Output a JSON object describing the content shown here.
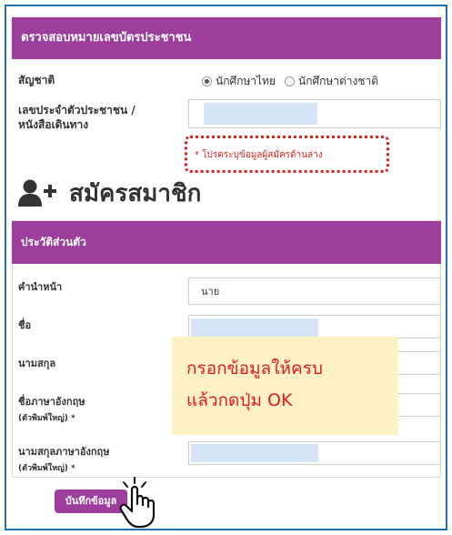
{
  "verify_section": {
    "header": "ตรวจสอบหมายเลขบัตรประชาชน",
    "nationality_label": "สัญชาติ",
    "nationality_options": [
      {
        "label": "นักศึกษาไทย",
        "selected": true
      },
      {
        "label": "นักศึกษาต่างชาติ",
        "selected": false
      }
    ],
    "id_label_line1": "เลขประจำตัวประชาชน /",
    "id_label_line2": "หนังสือเดินทาง",
    "required_note": "* โปรดระบุข้อมูลผู้สมัครด้านล่าง"
  },
  "register": {
    "title": "สมัครสมาชิก",
    "icon": "user-plus-icon"
  },
  "personal_section": {
    "header": "ประวัติส่วนตัว",
    "fields": {
      "prefix_label": "คำนำหน้า",
      "prefix_value": "นาย",
      "firstname_label": "ชื่อ",
      "lastname_label": "นามสกุล",
      "firstname_en_label": "ชื่อภาษาอังกฤษ",
      "firstname_en_hint": "(ตัวพิมพ์ใหญ่) *",
      "lastname_en_label": "นามสกุลภาษาอังกฤษ",
      "lastname_en_hint": "(ตัวพิมพ์ใหญ่) *"
    }
  },
  "callout": {
    "line1": "กรอกข้อมูลให้ครบ",
    "line2": "แล้วกดปุ่ม OK"
  },
  "submit_label": "บันทึกข้อมูล",
  "colors": {
    "header_purple": "#9c3f9c",
    "frame_blue": "#1f6fb2",
    "alert_red": "#d9231d",
    "callout_bg": "#fbf1c4",
    "input_fill": "#d6e4f7"
  }
}
